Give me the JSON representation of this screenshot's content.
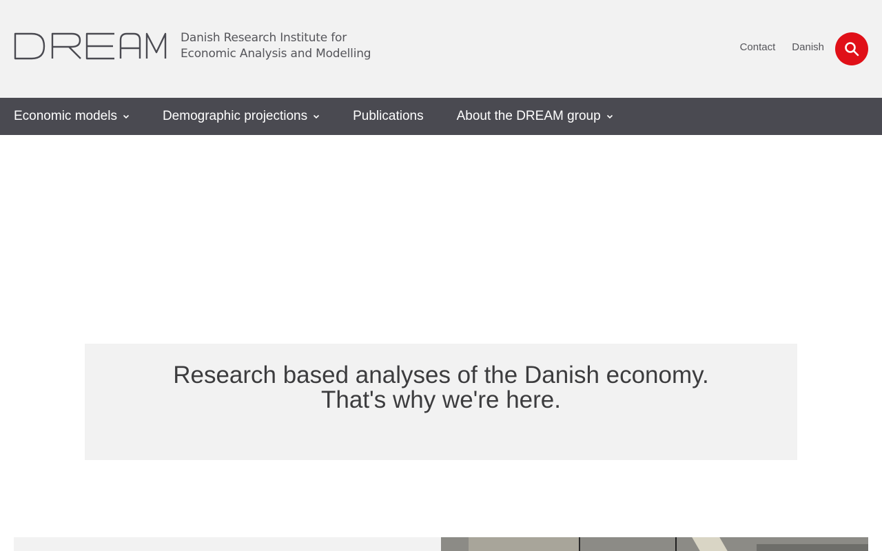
{
  "header": {
    "logo_wordmark": "DREAM",
    "logo_line1": "Danish Research Institute for",
    "logo_line2": "Economic Analysis and Modelling",
    "links": [
      "Contact",
      "Danish"
    ],
    "search_icon": "search-icon"
  },
  "nav": {
    "items": [
      {
        "label": "Economic models",
        "has_dropdown": true
      },
      {
        "label": "Demographic projections",
        "has_dropdown": true
      },
      {
        "label": "Publications",
        "has_dropdown": false
      },
      {
        "label": "About the DREAM group",
        "has_dropdown": true
      }
    ]
  },
  "hero": {
    "line1": "Research based analyses of the Danish economy.",
    "line2": "That's why we're here."
  },
  "colors": {
    "accent": "#e01018",
    "nav_bg": "#4a4a51",
    "header_bg": "#f2f2f2",
    "text": "#3c3c3e"
  }
}
